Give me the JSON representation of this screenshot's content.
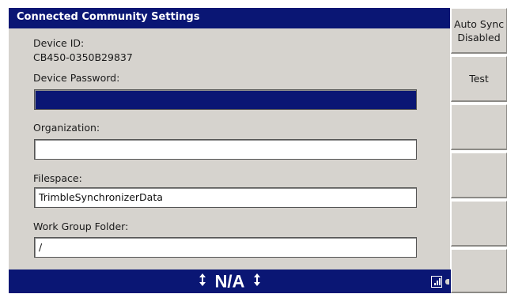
{
  "window": {
    "title": "Connected Community Settings"
  },
  "device": {
    "id_label": "Device ID:",
    "id_value": "CB450-0350B29837"
  },
  "fields": {
    "password": {
      "label": "Device Password:",
      "value": ""
    },
    "organization": {
      "label": "Organization:",
      "value": ""
    },
    "filespace": {
      "label": "Filespace:",
      "value": "TrimbleSynchronizerData"
    },
    "workgroup": {
      "label": "Work Group Folder:",
      "value": "/"
    }
  },
  "softkeys": {
    "auto_sync_line1": "Auto Sync",
    "auto_sync_line2": "Disabled",
    "test": "Test"
  },
  "status": {
    "value": "N/A"
  },
  "colors": {
    "title_bg": "#0a1674",
    "panel_bg": "#d6d3ce",
    "selected_field": "#0a1674"
  },
  "icons": {
    "status_left": "up-down-arrow-icon",
    "status_right": "up-down-arrow-icon",
    "corner": "signal-strength-icon"
  }
}
